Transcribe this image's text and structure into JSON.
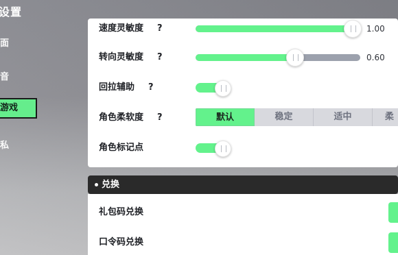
{
  "left_rail": {
    "title": "设置",
    "items": [
      {
        "label": "面",
        "active": false
      },
      {
        "label": "音",
        "active": false
      },
      {
        "label": "游戏",
        "active": true
      },
      {
        "label": "私",
        "active": false
      }
    ]
  },
  "settings": {
    "speed_sensitivity": {
      "label": "速度灵敏度",
      "help": "?",
      "value": "1.00",
      "fill_fraction": 0.95
    },
    "turn_sensitivity": {
      "label": "转向灵敏度",
      "help": "?",
      "value": "0.60",
      "fill_fraction": 0.6
    },
    "pull_assist": {
      "label": "回拉辅助",
      "help": "?",
      "enabled": true
    },
    "character_softness": {
      "label": "角色柔软度",
      "help": "?",
      "options": [
        "默认",
        "稳定",
        "适中",
        "柔"
      ],
      "selected": "默认"
    },
    "character_marker": {
      "label": "角色标记点",
      "enabled": true
    }
  },
  "redeem": {
    "section_title": "兑换",
    "items": [
      {
        "label": "礼包码兑换"
      },
      {
        "label": "口令码兑换"
      }
    ]
  },
  "colors": {
    "accent_green": "#63F28C",
    "track_gray": "#9CA1AD",
    "panel_white": "#FFFFFF",
    "section_dark": "#2A2A2A"
  }
}
